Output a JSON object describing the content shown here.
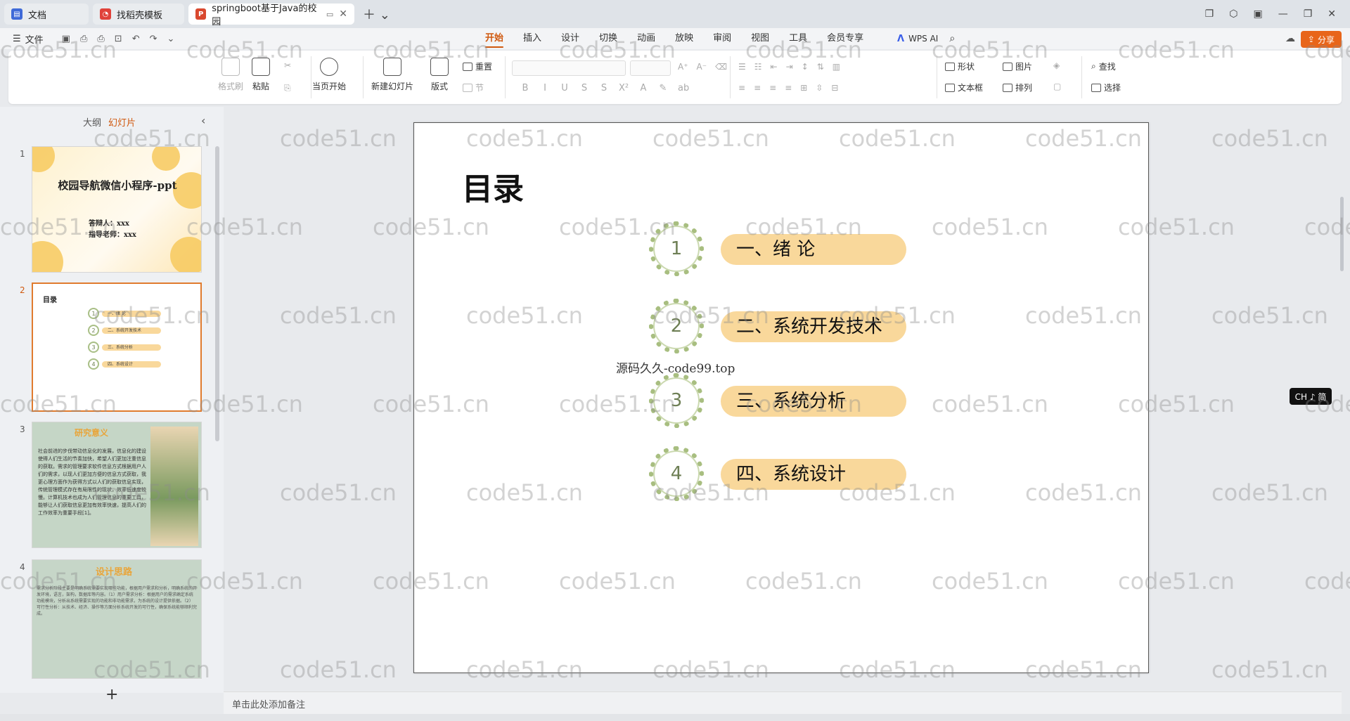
{
  "tabs": [
    {
      "label": "文档",
      "icon": "doc-icon"
    },
    {
      "label": "找稻壳模板",
      "icon": "docer-icon"
    },
    {
      "label": "springboot基于Java的校园",
      "icon": "ppt-icon"
    }
  ],
  "menu": {
    "file": "文件",
    "tabs": [
      "开始",
      "插入",
      "设计",
      "切换",
      "动画",
      "放映",
      "审阅",
      "视图",
      "工具",
      "会员专享"
    ],
    "active": "开始",
    "ai": "WPS AI",
    "share": "分享"
  },
  "ribbon": {
    "format_painter": "格式刷",
    "paste": "粘贴",
    "play_from_current": "当页开始",
    "new_slide": "新建幻灯片",
    "layout": "版式",
    "reset": "重置",
    "section": "节",
    "shapes": "形状",
    "picture": "图片",
    "textbox": "文本框",
    "arrange": "排列",
    "find": "查找",
    "select": "选择"
  },
  "leftpanel": {
    "outline_tab": "大纲",
    "slides_tab": "幻灯片",
    "add_slide": "+"
  },
  "thumbs": {
    "s1": {
      "title": "校园导航微信小程序-ppt",
      "l1": "答辩人：xxx",
      "l2": "指导老师：xxx"
    },
    "s2": {
      "title": "目录",
      "items": [
        "一、绪 论",
        "二、系统开发技术",
        "三、系统分析",
        "四、系统设计"
      ]
    },
    "s3": {
      "title": "研究意义",
      "body": "社会前进的步伐带动信息化的发展，信息化的建设使得人们生活的节奏加快，希望人们更加注重信息的获取。需求的管理要求软件信息方式根据用户人们的需求，以现人们更加方便的信息方式获取，我更心理方面作为获得方式以人们的获取信息实现，传统管理模式存在有局限性的现状，效率低速度较慢。计算机技术也成为人们管理信息的重要工具，能够让人们获取信息更加有效率快速，提高人们的工作效率为重要手段[1]。"
    },
    "s4": {
      "title": "设计思路",
      "body": "需求分析阶段主要是明确系统需要实现哪些功能，根据用户需求和分析，明确系统的开发环境，语言，架构，数据库等内容。（1）用户需求分析：根据用户的需求确定系统功能模块，分析出系统需要实现的功能和非功能需求，为系统的设计提供依据。（2）可行性分析：从技术、经济、操作等方面分析系统开发的可行性，确保系统能够顺利完成。"
    }
  },
  "slide": {
    "title": "目录",
    "items": [
      {
        "num": "1",
        "label": "一、绪 论"
      },
      {
        "num": "2",
        "label": "二、系统开发技术"
      },
      {
        "num": "3",
        "label": "三、系统分析"
      },
      {
        "num": "4",
        "label": "四、系统设计"
      }
    ]
  },
  "overlay_text": "源码久久-code99.top",
  "ime": "CH ♪ 简",
  "notes_placeholder": "单击此处添加备注",
  "watermark": "code51.cn",
  "colors": {
    "accent": "#d0590f",
    "pill": "#f9d89b",
    "wreath": "#a8be80"
  }
}
